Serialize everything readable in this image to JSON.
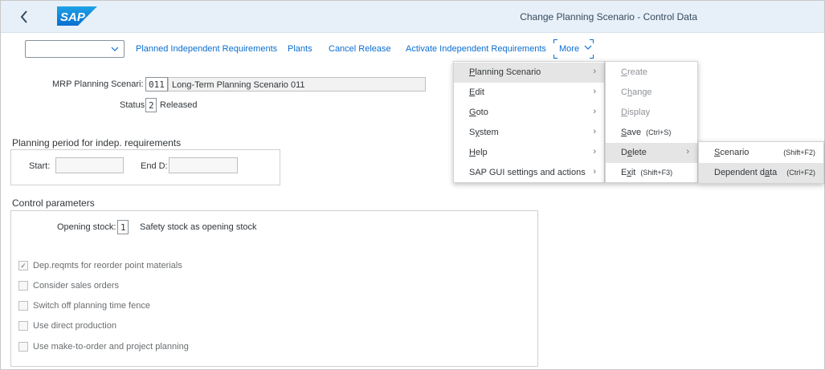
{
  "header": {
    "title": "Change Planning Scenario - Control Data",
    "logo_text": "SAP",
    "back_icon": "chevron-left-icon"
  },
  "toolbar": {
    "dropdown_value": "",
    "buttons": [
      "Planned Independent Requirements",
      "Plants",
      "Cancel Release",
      "Activate Independent Requirements"
    ],
    "more_label": "More"
  },
  "scenario": {
    "label": "MRP Planning Scenari:",
    "code": "011",
    "description": "Long-Term Planning Scenario 011",
    "status_label": "Status:",
    "status_code": "2",
    "status_text": "Released"
  },
  "planning_period": {
    "title": "Planning period for indep. requirements",
    "start_label": "Start:",
    "end_label": "End D:"
  },
  "control": {
    "title": "Control parameters",
    "opening_stock_label": "Opening stock:",
    "opening_stock_code": "1",
    "opening_stock_text": "Safety stock as opening stock",
    "checkboxes": [
      {
        "label": "Dep.reqmts for reorder point materials",
        "checked": true
      },
      {
        "label": "Consider sales orders",
        "checked": false
      },
      {
        "label": "Switch off planning time fence",
        "checked": false
      },
      {
        "label": "Use direct production",
        "checked": false
      },
      {
        "label": "Use make-to-order and project planning",
        "checked": false
      }
    ]
  },
  "menu_main": {
    "items": [
      "Planning Scenario",
      "Edit",
      "Goto",
      "System",
      "Help",
      "SAP GUI settings and actions"
    ],
    "mnemonics": [
      "P",
      "E",
      "G",
      "y",
      "H",
      ""
    ]
  },
  "menu_sub": {
    "items": [
      {
        "label": "Create",
        "shortcut": ""
      },
      {
        "label": "Change",
        "shortcut": ""
      },
      {
        "label": "Display",
        "shortcut": ""
      },
      {
        "label": "Save",
        "shortcut": "(Ctrl+S)"
      },
      {
        "label": "Delete",
        "shortcut": ""
      },
      {
        "label": "Exit",
        "shortcut": "(Shift+F3)"
      }
    ]
  },
  "menu_delete": {
    "items": [
      {
        "label": "Scenario",
        "shortcut": "(Shift+F2)"
      },
      {
        "label": "Dependent data",
        "shortcut": "(Ctrl+F2)"
      }
    ]
  },
  "colors": {
    "accent": "#0a6ed1",
    "header_bg": "#e7f0f8",
    "logo_blue": "#1a8fd8"
  }
}
